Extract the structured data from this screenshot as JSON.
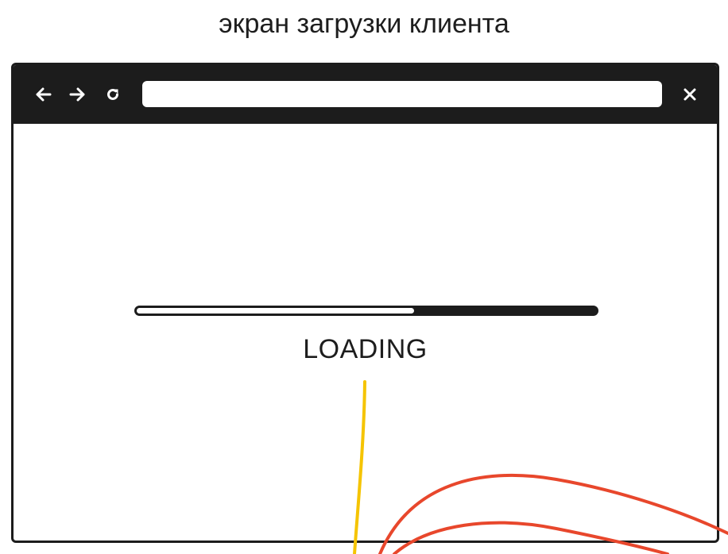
{
  "caption": "экран загрузки клиента",
  "browser": {
    "toolbar": {
      "back_icon": "arrow-left-icon",
      "forward_icon": "arrow-right-icon",
      "reload_icon": "reload-icon",
      "close_icon": "close-icon",
      "address_value": ""
    },
    "content": {
      "progress": 0.6,
      "loading_label": "LOADING"
    }
  },
  "colors": {
    "frame": "#1c1c1c",
    "background": "#ffffff",
    "annotation_yellow": "#f5c400",
    "annotation_red": "#e8472c"
  }
}
